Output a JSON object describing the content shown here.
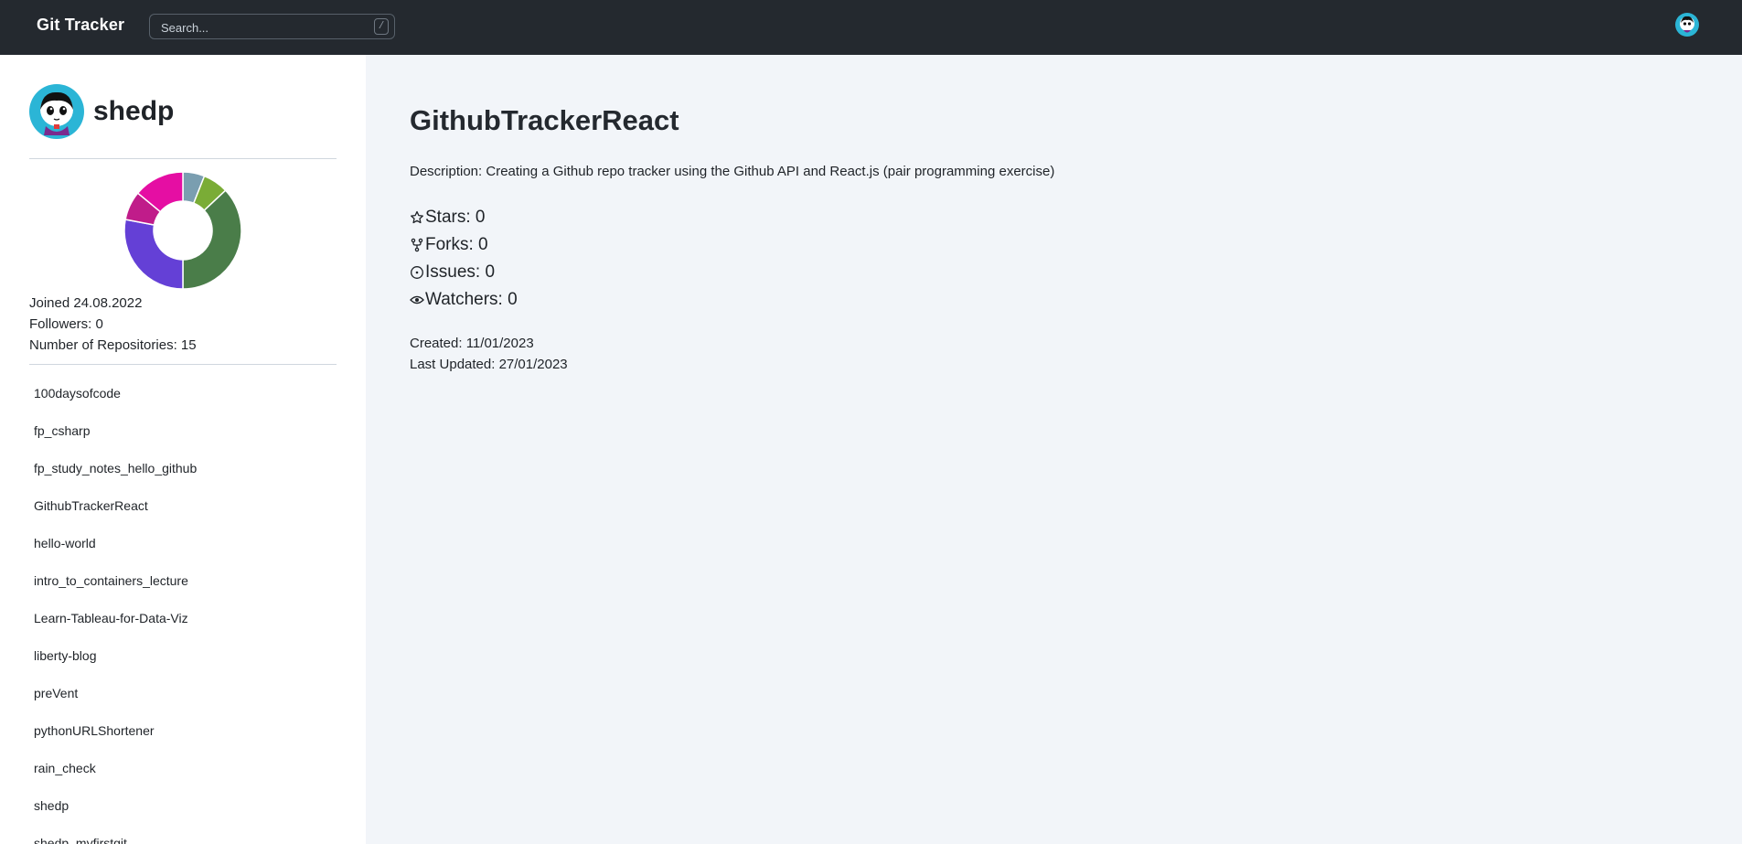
{
  "header": {
    "brand": "Git Tracker",
    "search_placeholder": "Search...",
    "search_shortcut": "/"
  },
  "profile": {
    "username": "shedp",
    "joined": "Joined 24.08.2022",
    "followers": "Followers: 0",
    "repo_count": "Number of Repositories: 15"
  },
  "language_chart": {
    "type": "pie",
    "colors": [
      "#7a9eb0",
      "#7aac36",
      "#4a7d49",
      "#6440d6",
      "#c01c8a",
      "#e50ea3"
    ],
    "values": [
      0.06,
      0.07,
      0.37,
      0.28,
      0.08,
      0.14
    ]
  },
  "repos": [
    "100daysofcode",
    "fp_csharp",
    "fp_study_notes_hello_github",
    "GithubTrackerReact",
    "hello-world",
    "intro_to_containers_lecture",
    "Learn-Tableau-for-Data-Viz",
    "liberty-blog",
    "preVent",
    "pythonURLShortener",
    "rain_check",
    "shedp",
    "shedp_myfirstgit"
  ],
  "repo_detail": {
    "title": "GithubTrackerReact",
    "description": "Description: Creating a Github repo tracker using the Github API and React.js (pair programming exercise)",
    "stars": "Stars: 0",
    "forks": "Forks: 0",
    "issues": "Issues: 0",
    "watchers": "Watchers: 0",
    "created": "Created: 11/01/2023",
    "updated": "Last Updated: 27/01/2023"
  },
  "icons": {
    "star": "star-icon",
    "fork": "fork-icon",
    "issue": "issue-icon",
    "watch": "eye-icon"
  }
}
